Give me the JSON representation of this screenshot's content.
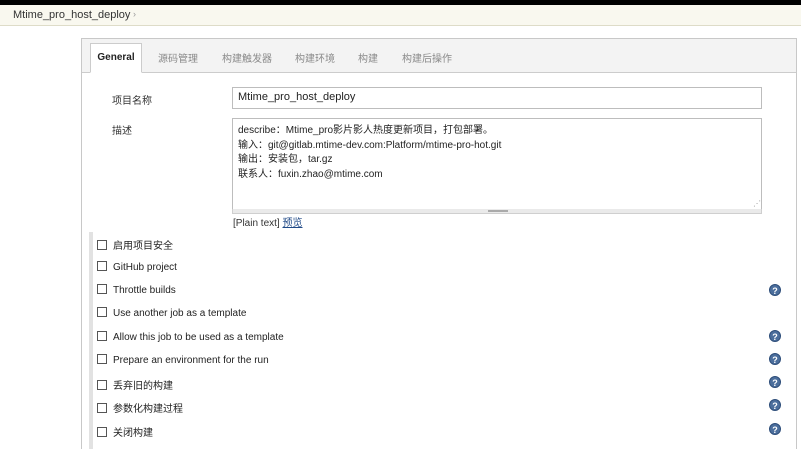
{
  "breadcrumb": {
    "job": "Mtime_pro_host_deploy",
    "arrow": "›"
  },
  "tabs": [
    {
      "label": "General"
    },
    {
      "label": "源码管理"
    },
    {
      "label": "构建触发器"
    },
    {
      "label": "构建环境"
    },
    {
      "label": "构建"
    },
    {
      "label": "构建后操作"
    }
  ],
  "form": {
    "project_name_label": "项目名称",
    "project_name_value": "Mtime_pro_host_deploy",
    "description_label": "描述",
    "description_lines": [
      "describe：Mtime_pro影片影人热度更新项目，打包部署。",
      "输入：git@gitlab.mtime-dev.com:Platform/mtime-pro-hot.git",
      "输出：安装包，tar.gz",
      "联系人：fuxin.zhao@mtime.com"
    ],
    "plain_text": "[Plain text]",
    "preview_link": "预览"
  },
  "options": [
    {
      "label": "启用项目安全",
      "help": false
    },
    {
      "label": "GitHub project",
      "help": false
    },
    {
      "label": "Throttle builds",
      "help": true
    },
    {
      "label": "Use another job as a template",
      "help": false
    },
    {
      "label": "Allow this job to be used as a template",
      "help": true
    },
    {
      "label": "Prepare an environment for the run",
      "help": true
    },
    {
      "label": "丢弃旧的构建",
      "help": true
    },
    {
      "label": "参数化构建过程",
      "help": true
    },
    {
      "label": "关闭构建",
      "help": true
    }
  ],
  "help_glyph": "?"
}
